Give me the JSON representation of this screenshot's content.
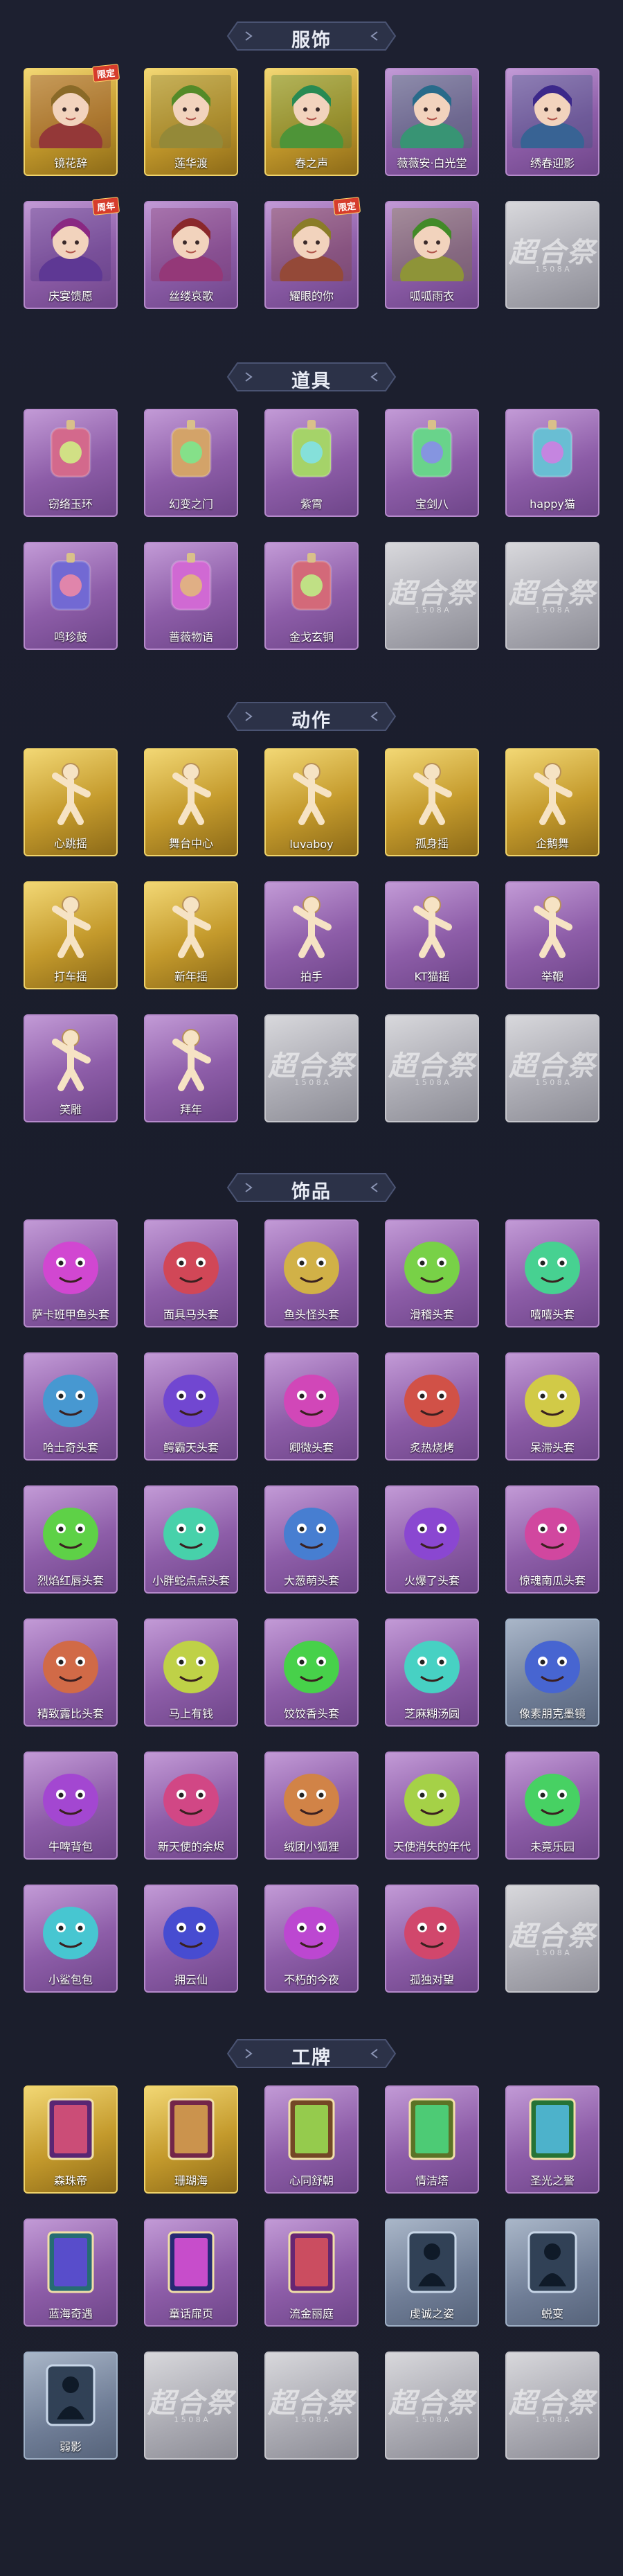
{
  "sections": [
    {
      "title": "服饰",
      "items": [
        {
          "label": "镜花辞",
          "style": "gold",
          "badge": "限定",
          "art": "portrait"
        },
        {
          "label": "莲华渡",
          "style": "gold",
          "badge": "",
          "art": "portrait"
        },
        {
          "label": "春之声",
          "style": "gold",
          "badge": "",
          "art": "portrait"
        },
        {
          "label": "薇薇安·白光堂",
          "style": "purple",
          "badge": "",
          "art": "portrait"
        },
        {
          "label": "绣春迎影",
          "style": "purple",
          "badge": "",
          "art": "portrait"
        },
        {
          "label": "庆宴馈愿",
          "style": "purple",
          "badge": "周年",
          "art": "portrait"
        },
        {
          "label": "丝缕哀歌",
          "style": "purple",
          "badge": "",
          "art": "portrait"
        },
        {
          "label": "耀眼的你",
          "style": "purple",
          "badge": "限定",
          "art": "portrait"
        },
        {
          "label": "呱呱雨衣",
          "style": "purple",
          "badge": "",
          "art": "portrait"
        },
        {
          "label": "",
          "style": "grey",
          "badge": "",
          "art": "placeholder"
        }
      ]
    },
    {
      "title": "道具",
      "items": [
        {
          "label": "窃络玉环",
          "style": "purple",
          "badge": "",
          "art": "prop"
        },
        {
          "label": "幻变之门",
          "style": "purple",
          "badge": "",
          "art": "prop"
        },
        {
          "label": "紫霄",
          "style": "purple",
          "badge": "",
          "art": "prop"
        },
        {
          "label": "宝剑八",
          "style": "purple",
          "badge": "",
          "art": "prop"
        },
        {
          "label": "happy猫",
          "style": "purple",
          "badge": "",
          "art": "prop"
        },
        {
          "label": "鸣珍鼓",
          "style": "purple",
          "badge": "",
          "art": "prop"
        },
        {
          "label": "蔷薇物语",
          "style": "purple",
          "badge": "",
          "art": "prop"
        },
        {
          "label": "金戈玄铜",
          "style": "purple",
          "badge": "",
          "art": "prop"
        },
        {
          "label": "",
          "style": "grey",
          "badge": "",
          "art": "placeholder"
        },
        {
          "label": "",
          "style": "grey",
          "badge": "",
          "art": "placeholder"
        }
      ]
    },
    {
      "title": "动作",
      "items": [
        {
          "label": "心跳摇",
          "style": "gold",
          "badge": "",
          "art": "pose"
        },
        {
          "label": "舞台中心",
          "style": "gold",
          "badge": "",
          "art": "pose"
        },
        {
          "label": "luvaboy",
          "style": "gold",
          "badge": "",
          "art": "pose"
        },
        {
          "label": "孤身摇",
          "style": "gold",
          "badge": "",
          "art": "pose"
        },
        {
          "label": "企鹅舞",
          "style": "gold",
          "badge": "",
          "art": "pose"
        },
        {
          "label": "打车摇",
          "style": "gold",
          "badge": "",
          "art": "pose"
        },
        {
          "label": "新年摇",
          "style": "gold",
          "badge": "",
          "art": "pose"
        },
        {
          "label": "拍手",
          "style": "purple",
          "badge": "",
          "art": "pose"
        },
        {
          "label": "KT猫摇",
          "style": "purple",
          "badge": "",
          "art": "pose"
        },
        {
          "label": "举鞭",
          "style": "purple",
          "badge": "",
          "art": "pose"
        },
        {
          "label": "笑雕",
          "style": "purple",
          "badge": "",
          "art": "pose"
        },
        {
          "label": "拜年",
          "style": "purple",
          "badge": "",
          "art": "pose"
        },
        {
          "label": "",
          "style": "grey",
          "badge": "",
          "art": "placeholder"
        },
        {
          "label": "",
          "style": "grey",
          "badge": "",
          "art": "placeholder"
        },
        {
          "label": "",
          "style": "grey",
          "badge": "",
          "art": "placeholder"
        }
      ]
    },
    {
      "title": "饰品",
      "items": [
        {
          "label": "萨卡班甲鱼头套",
          "style": "purple",
          "badge": "",
          "art": "head"
        },
        {
          "label": "面具马头套",
          "style": "purple",
          "badge": "",
          "art": "head"
        },
        {
          "label": "鱼头怪头套",
          "style": "purple",
          "badge": "",
          "art": "head"
        },
        {
          "label": "滑稽头套",
          "style": "purple",
          "badge": "",
          "art": "head"
        },
        {
          "label": "嘻嘻头套",
          "style": "purple",
          "badge": "",
          "art": "head"
        },
        {
          "label": "哈士奇头套",
          "style": "purple",
          "badge": "",
          "art": "head"
        },
        {
          "label": "鳄霸天头套",
          "style": "purple",
          "badge": "",
          "art": "head"
        },
        {
          "label": "卿微头套",
          "style": "purple",
          "badge": "",
          "art": "head"
        },
        {
          "label": "炙热烧烤",
          "style": "purple",
          "badge": "",
          "art": "head"
        },
        {
          "label": "呆滞头套",
          "style": "purple",
          "badge": "",
          "art": "head"
        },
        {
          "label": "烈焰红唇头套",
          "style": "purple",
          "badge": "",
          "art": "head"
        },
        {
          "label": "小胖蛇点点头套",
          "style": "purple",
          "badge": "",
          "art": "head"
        },
        {
          "label": "大葱萌头套",
          "style": "purple",
          "badge": "",
          "art": "head"
        },
        {
          "label": "火爆了头套",
          "style": "purple",
          "badge": "",
          "art": "head"
        },
        {
          "label": "惊魂南瓜头套",
          "style": "purple",
          "badge": "",
          "art": "head"
        },
        {
          "label": "精致露比头套",
          "style": "purple",
          "badge": "",
          "art": "head"
        },
        {
          "label": "马上有钱",
          "style": "purple",
          "badge": "",
          "art": "head"
        },
        {
          "label": "饺饺香头套",
          "style": "purple",
          "badge": "",
          "art": "head"
        },
        {
          "label": "芝麻糊汤圆",
          "style": "purple",
          "badge": "",
          "art": "head"
        },
        {
          "label": "像素朋克墨镜",
          "style": "steel",
          "badge": "",
          "art": "head"
        },
        {
          "label": "牛啤背包",
          "style": "purple",
          "badge": "",
          "art": "head"
        },
        {
          "label": "新天使的余烬",
          "style": "purple",
          "badge": "",
          "art": "head"
        },
        {
          "label": "绒团小狐狸",
          "style": "purple",
          "badge": "",
          "art": "head"
        },
        {
          "label": "天使消失的年代",
          "style": "purple",
          "badge": "",
          "art": "head"
        },
        {
          "label": "未竟乐园",
          "style": "purple",
          "badge": "",
          "art": "head"
        },
        {
          "label": "小鲨包包",
          "style": "purple",
          "badge": "",
          "art": "head"
        },
        {
          "label": "拥云仙",
          "style": "purple",
          "badge": "",
          "art": "head"
        },
        {
          "label": "不朽的今夜",
          "style": "purple",
          "badge": "",
          "art": "head"
        },
        {
          "label": "孤独对望",
          "style": "purple",
          "badge": "",
          "art": "head"
        },
        {
          "label": "",
          "style": "grey",
          "badge": "",
          "art": "placeholder"
        }
      ]
    },
    {
      "title": "工牌",
      "items": [
        {
          "label": "森珠帝",
          "style": "gold",
          "badge": "",
          "art": "card"
        },
        {
          "label": "珊瑚海",
          "style": "gold",
          "badge": "",
          "art": "card"
        },
        {
          "label": "心同舒朝",
          "style": "purple",
          "badge": "",
          "art": "card"
        },
        {
          "label": "情洁塔",
          "style": "purple",
          "badge": "",
          "art": "card"
        },
        {
          "label": "圣光之警",
          "style": "purple",
          "badge": "",
          "art": "card"
        },
        {
          "label": "蓝海奇遇",
          "style": "purple",
          "badge": "",
          "art": "card"
        },
        {
          "label": "童话扉页",
          "style": "purple",
          "badge": "",
          "art": "card"
        },
        {
          "label": "流金丽庭",
          "style": "purple",
          "badge": "",
          "art": "card"
        },
        {
          "label": "虔诚之姿",
          "style": "steel",
          "badge": "",
          "art": "silhouette"
        },
        {
          "label": "蜕变",
          "style": "steel",
          "badge": "",
          "art": "silhouette"
        },
        {
          "label": "弱影",
          "style": "steel",
          "badge": "",
          "art": "silhouette"
        },
        {
          "label": "",
          "style": "grey",
          "badge": "",
          "art": "placeholder"
        },
        {
          "label": "",
          "style": "grey",
          "badge": "",
          "art": "placeholder"
        },
        {
          "label": "",
          "style": "grey",
          "badge": "",
          "art": "placeholder"
        },
        {
          "label": "",
          "style": "grey",
          "badge": "",
          "art": "placeholder"
        }
      ]
    }
  ],
  "placeholder_logo": "超合祭",
  "placeholder_sub": "1 5 0 8 A",
  "colors": {
    "background": "#1b1e2c",
    "header_band": "#2c3248",
    "purple_card": "#a476bd",
    "gold_card": "#e0bd4f",
    "grey_card": "#bfbfc5",
    "steel_card": "#7d8ba3"
  }
}
